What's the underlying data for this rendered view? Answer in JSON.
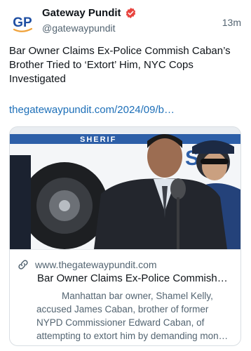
{
  "header": {
    "avatar_text": "GP",
    "display_name": "Gateway Pundit",
    "handle": "@gatewaypundit",
    "timestamp": "13m",
    "verified": "verified-badge-icon"
  },
  "post": {
    "text": "Bar Owner Claims Ex-Police Commish Caban’s Brother Tried to ‘Extort’ Him, NYC Cops Investigated",
    "link": "thegatewaypundit.com/2024/09/b…"
  },
  "card": {
    "domain": "www.thegatewaypundit.com",
    "title": "Bar Owner Claims Ex-Police Commish…",
    "description": "Manhattan bar owner, Shamel Kelly, accused James Caban, brother of former NYPD Commissioner Edward Caban, of attempting to extort him by demanding mon…",
    "image_van_text": "SHERIF",
    "image_cap_text": "SH",
    "link_icon": "link-icon"
  },
  "colors": {
    "link": "#1d6fb8",
    "verified": "#e8443f",
    "avatar_blue": "#1f4fa3",
    "avatar_orange": "#f0a23a",
    "secondary_text": "#536471"
  }
}
